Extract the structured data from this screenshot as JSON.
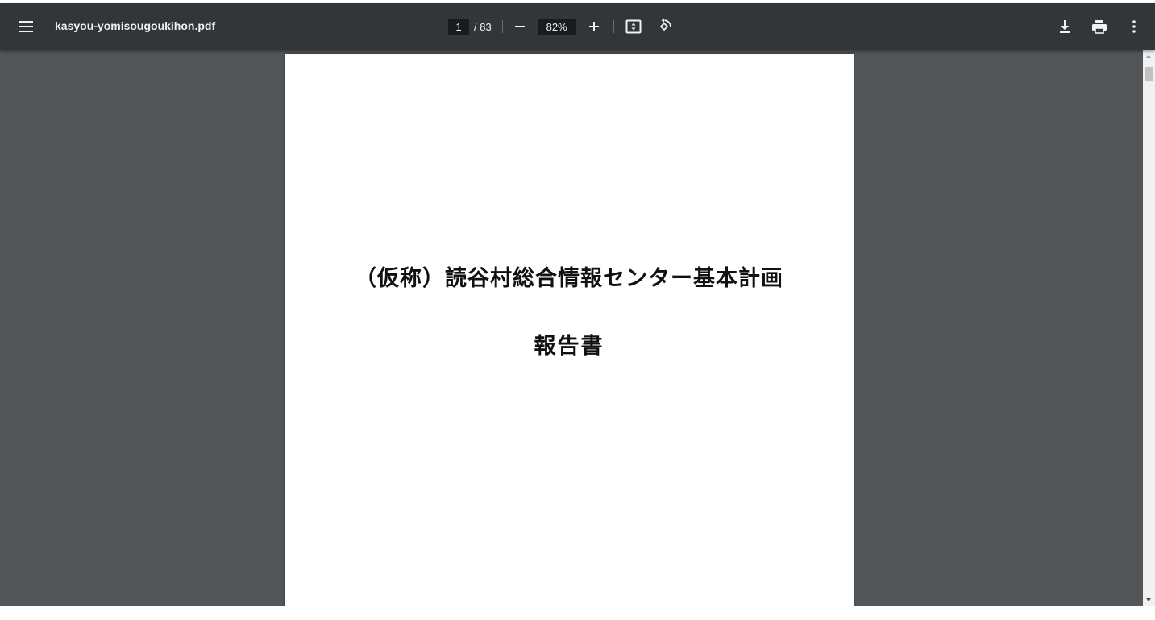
{
  "toolbar": {
    "menu_icon": "hamburger-menu-icon",
    "file_name": "kasyou-yomisougoukihon.pdf",
    "page_current": "1",
    "page_total_label": "/ 83",
    "zoom_out_icon": "minus-icon",
    "zoom_value": "82%",
    "zoom_in_icon": "plus-icon",
    "fit_icon": "fit-to-page-icon",
    "rotate_icon": "rotate-counterclockwise-icon",
    "download_icon": "download-icon",
    "print_icon": "print-icon",
    "more_icon": "more-vertical-icon"
  },
  "document": {
    "title": "（仮称）読谷村総合情報センター基本計画",
    "subtitle": "報告書"
  },
  "colors": {
    "toolbar_bg": "#323639",
    "viewer_bg": "#525659",
    "input_bg": "#191b1c",
    "icon_color": "#f1f1f1",
    "scrollbar_bg": "#f1f1f1",
    "scrollbar_thumb": "#c1c1c1"
  }
}
